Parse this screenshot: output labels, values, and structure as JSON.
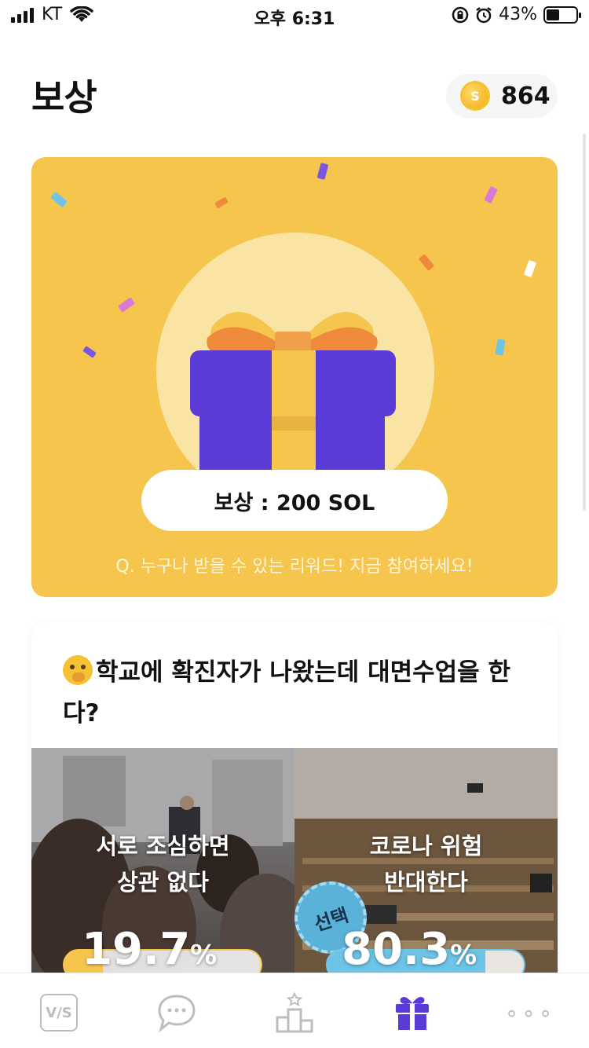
{
  "status_bar": {
    "carrier": "KT",
    "time": "오후 6:31",
    "battery": "43%"
  },
  "header": {
    "title": "보상",
    "coin_balance": "864",
    "coin_symbol": "S"
  },
  "reward_card": {
    "reward_text": "보상 : 200 SOL",
    "note": "Q. 누구나 받을 수 있는 리워드! 지금 참여하세요!",
    "colors": {
      "background": "#f6c54e",
      "box": "#5b3bd6",
      "ribbon": "#f6c54e",
      "bow": "#ef8a3b"
    }
  },
  "poll": {
    "question": "학교에 확진자가 나왔는데 대면수업을 한다?",
    "options": [
      {
        "label_line1": "서로 조심하면",
        "label_line2": "상관 없다",
        "percent_value": "19.7",
        "percent_unit": "%",
        "fraction": 0.197,
        "color": "#f6c54e"
      },
      {
        "label_line1": "코로나 위험",
        "label_line2": "반대한다",
        "percent_value": "80.3",
        "percent_unit": "%",
        "fraction": 0.803,
        "color": "#6ec4e6",
        "badge": "선택"
      }
    ]
  },
  "tab_bar": {
    "items": [
      {
        "name": "vs",
        "icon": "vs-icon",
        "label": "V/S",
        "active": false
      },
      {
        "name": "chat",
        "icon": "chat-bubble-icon",
        "active": false
      },
      {
        "name": "ranking",
        "icon": "podium-icon",
        "active": false
      },
      {
        "name": "reward",
        "icon": "gift-icon",
        "active": true
      },
      {
        "name": "more",
        "icon": "more-dots-icon",
        "label": "∘∘∘",
        "active": false
      }
    ],
    "active_color": "#5b3bd6",
    "inactive_color": "#bdbdbd"
  }
}
